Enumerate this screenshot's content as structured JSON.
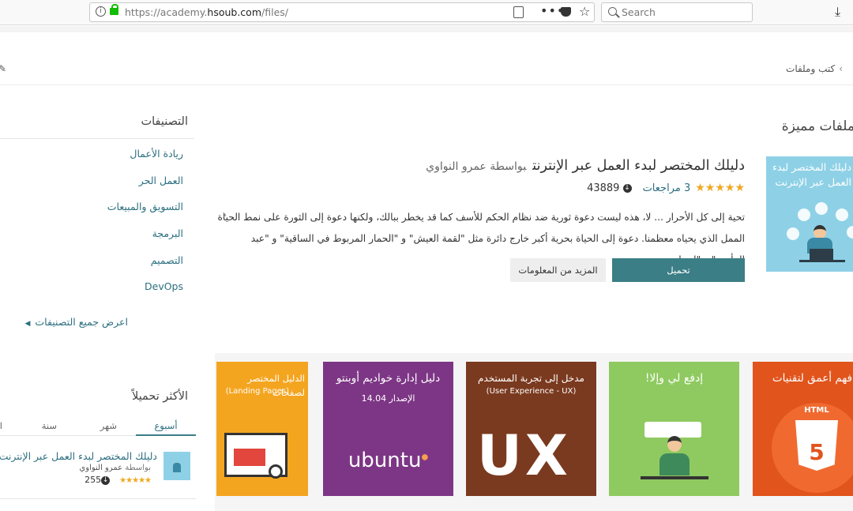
{
  "browser": {
    "url_prefix": "https://academy.",
    "url_domain": "hsoub.com",
    "url_path": "/files/",
    "search_placeholder": "Search"
  },
  "breadcrumb": {
    "item": "كتب وملفات"
  },
  "featured": {
    "section_title": "ملفات مميزة",
    "cover_title": "دليلك المختصر لبدء العمل عبر الإنترنت",
    "title": "دليلك المختصر لبدء العمل عبر الإنترنت",
    "author": "بواسطة عمرو النواوي",
    "stars": "★★★★★",
    "reviews": "3 مراجعات",
    "downloads": "43889",
    "description": "تحية إلى كل الأحرار ... لا، هذه ليست دعوة ثورية ضد نظام الحكم للأسف كما قد يخطر ببالك، ولكنها دعوة إلى الثورة على نمط الحياة الممل الذي يحياه معظمنا. دعوة إلى الحياة بحرية أكبر خارج دائرة مثل \"لقمة العيش\" و \"الحمار المربوط في الساقية\" و \"عبد المأمور\" و \"اربط...",
    "download_button": "تحميل",
    "more_button": "المزيد من المعلومات"
  },
  "categories": {
    "title": "التصنيفات",
    "items": [
      "ريادة الأعمال",
      "العمل الحر",
      "التسويق والمبيعات",
      "البرمجة",
      "التصميم",
      "DevOps"
    ],
    "show_all": "اعرض جميع التصنيفات"
  },
  "tiles": {
    "landing_title": "الدليل المختصر لصفحات",
    "landing_sub": "(Landing Pages)",
    "ubuntu_title": "دليل إدارة خواديم أوبنتو",
    "ubuntu_sub": "الإصدار 14.04",
    "ubuntu_word": "ubuntu",
    "ux_title": "مدخل إلى تجربة المستخدم",
    "ux_sub": "(User Experience - UX)",
    "ux_word": "UX",
    "push_title": "إدفع لي وإلا!",
    "html_title": "فهم أعمق لتقنيات",
    "html_label": "HTML",
    "html_num": "5"
  },
  "most_downloaded": {
    "title": "الأكثر تحميلاً",
    "tabs": [
      "أسبوع",
      "شهر",
      "سنة",
      "ا"
    ],
    "item_title": "دليلك المختصر لبدء العمل عبر الإنترنت",
    "item_author_prefix": "بواسطة",
    "item_author": "عمرو النواوي",
    "item_stars": "★★★★★",
    "item_downloads": "255"
  }
}
